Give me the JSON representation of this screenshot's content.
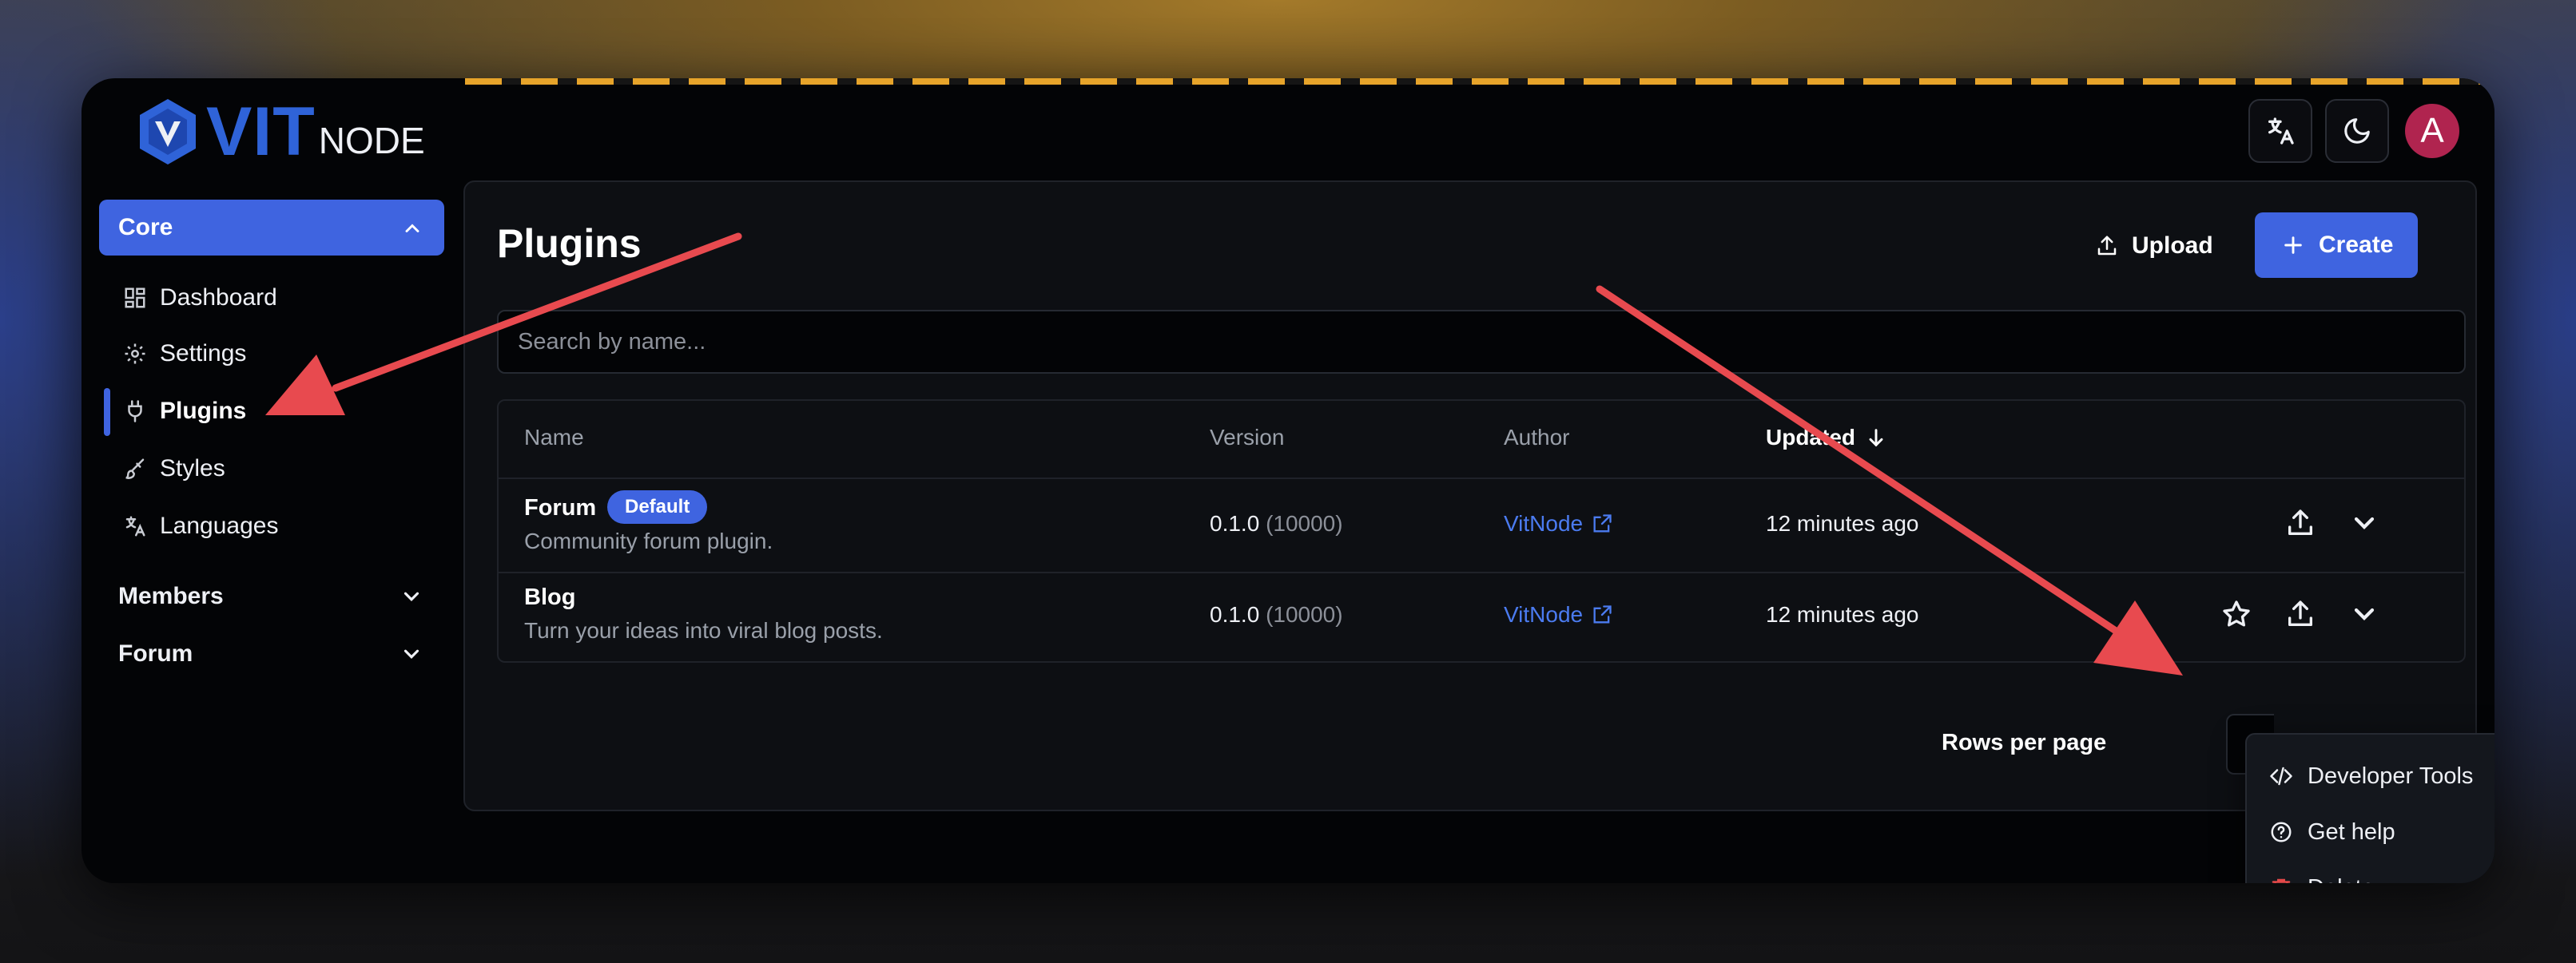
{
  "brand": {
    "vit": "VIT",
    "node": "NODE",
    "logo_icon": "vitnode-logo-icon"
  },
  "header": {
    "language_icon": "translate-icon",
    "theme_icon": "moon-icon",
    "avatar_initial": "A",
    "avatar_color": "#b0244f"
  },
  "sidebar": {
    "core_label": "Core",
    "items": [
      {
        "label": "Dashboard",
        "icon": "dashboard-icon"
      },
      {
        "label": "Settings",
        "icon": "gear-icon"
      },
      {
        "label": "Plugins",
        "icon": "plug-icon",
        "active": true
      },
      {
        "label": "Styles",
        "icon": "brush-icon"
      },
      {
        "label": "Languages",
        "icon": "translate-icon"
      }
    ],
    "groups": [
      {
        "label": "Members"
      },
      {
        "label": "Forum"
      }
    ]
  },
  "main": {
    "title": "Plugins",
    "upload_label": "Upload",
    "create_label": "Create",
    "search_placeholder": "Search by name...",
    "table": {
      "columns": [
        "Name",
        "Version",
        "Author",
        "Updated"
      ],
      "rows": [
        {
          "name": "Forum",
          "badge": "Default",
          "description": "Community forum plugin.",
          "version": "0.1.0",
          "version_code": "(10000)",
          "author": "VitNode",
          "updated": "12 minutes ago"
        },
        {
          "name": "Blog",
          "description": "Turn your ideas into viral blog posts.",
          "version": "0.1.0",
          "version_code": "(10000)",
          "author": "VitNode",
          "updated": "12 minutes ago"
        }
      ]
    },
    "rows_per_page_label": "Rows per page"
  },
  "dropdown": {
    "items": [
      {
        "label": "Developer Tools",
        "icon": "code-icon"
      },
      {
        "label": "Get help",
        "icon": "help-circle-icon"
      },
      {
        "label": "Delete",
        "icon": "trash-icon"
      }
    ]
  },
  "colors": {
    "accent": "#3f64e0",
    "annotation_arrow": "#e84a4f",
    "danger": "#e34848"
  }
}
